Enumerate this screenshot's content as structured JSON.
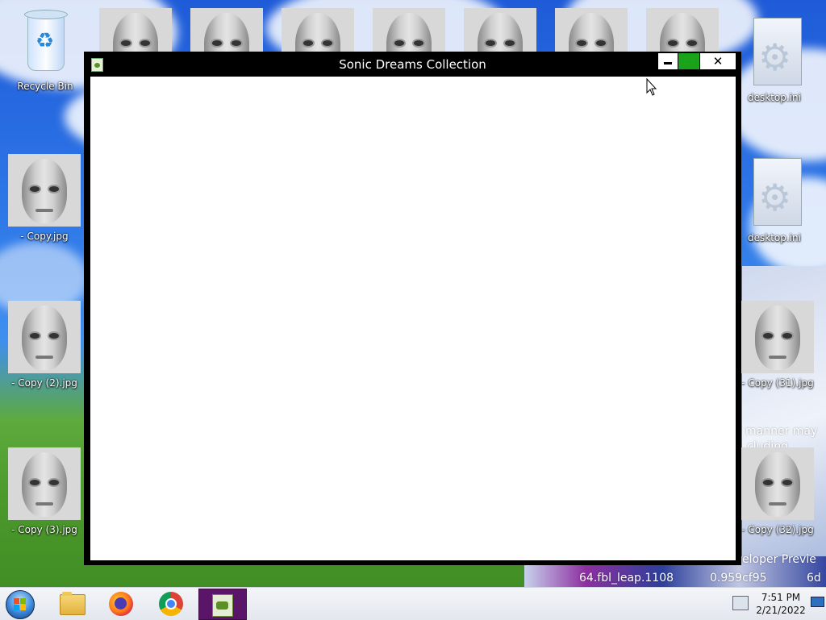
{
  "desktop": {
    "icons": [
      {
        "label": "Recycle Bin",
        "icon": "recycle-bin-icon"
      },
      {
        "label": "- Copy.jpg",
        "icon": "face-image-icon"
      },
      {
        "label": "- Copy (2).jpg",
        "icon": "face-image-icon"
      },
      {
        "label": "- Copy (3).jpg",
        "icon": "face-image-icon"
      },
      {
        "label": "desktop.ini",
        "icon": "settings-file-icon"
      },
      {
        "label": "desktop.ini",
        "icon": "settings-file-icon"
      },
      {
        "label": "- Copy (31).jpg",
        "icon": "face-image-icon"
      },
      {
        "label": "- Copy (32).jpg",
        "icon": "face-image-icon"
      }
    ],
    "wallpaper_text": {
      "line1": "manner may",
      "line2": "cluding",
      "line3": "eloper Previe",
      "line4": "64.fbl_leap.1108",
      "line5": "0.959cf95",
      "line6": "6d"
    }
  },
  "window": {
    "title": "Sonic Dreams Collection",
    "buttons": {
      "minimize": "minimize",
      "maximize": "maximize",
      "close": "✕"
    }
  },
  "taskbar": {
    "pinned": [
      "windows-explorer-icon",
      "firefox-icon",
      "chrome-icon",
      "sonic-dreams-collection-icon"
    ],
    "active_app": "Sonic Dreams Collection",
    "clock": {
      "time": "7:51 PM",
      "date": "2/21/2022"
    }
  },
  "colors": {
    "window_frame": "#000000",
    "maximize_button": "#1aa21a",
    "active_task": "#5a1568"
  }
}
